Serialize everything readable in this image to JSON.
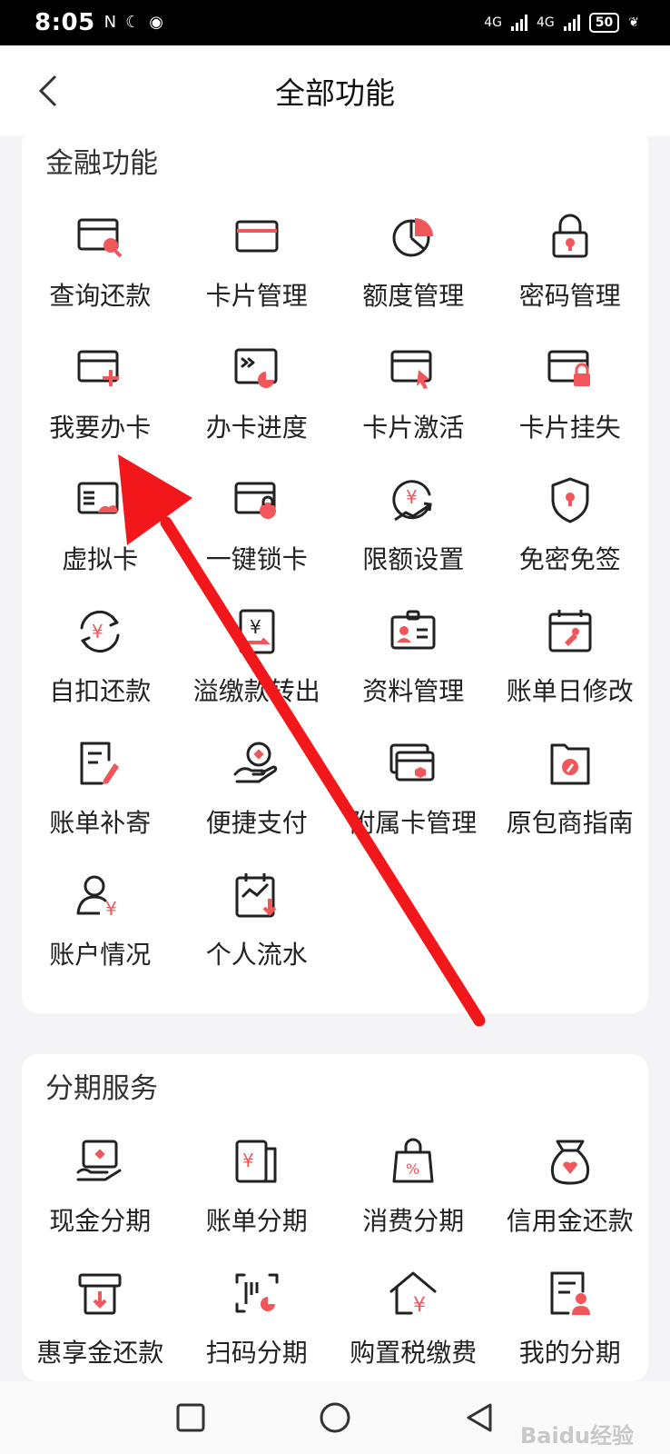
{
  "status_bar": {
    "time": "8:05",
    "network1": "4G",
    "network2": "4G",
    "battery": "50"
  },
  "header": {
    "title": "全部功能"
  },
  "sections": [
    {
      "title": "金融功能",
      "items": [
        {
          "label": "查询还款",
          "icon": "card-search-icon"
        },
        {
          "label": "卡片管理",
          "icon": "card-icon"
        },
        {
          "label": "额度管理",
          "icon": "pie-chart-icon"
        },
        {
          "label": "密码管理",
          "icon": "lock-icon"
        },
        {
          "label": "我要办卡",
          "icon": "card-add-icon"
        },
        {
          "label": "办卡进度",
          "icon": "card-progress-icon"
        },
        {
          "label": "卡片激活",
          "icon": "card-activate-icon"
        },
        {
          "label": "卡片挂失",
          "icon": "card-lock-icon"
        },
        {
          "label": "虚拟卡",
          "icon": "virtual-card-icon"
        },
        {
          "label": "一键锁卡",
          "icon": "card-onekey-lock-icon"
        },
        {
          "label": "限额设置",
          "icon": "limit-setting-icon"
        },
        {
          "label": "免密免签",
          "icon": "shield-icon"
        },
        {
          "label": "自扣还款",
          "icon": "auto-repay-icon"
        },
        {
          "label": "溢缴款转出",
          "icon": "overpay-transfer-icon"
        },
        {
          "label": "资料管理",
          "icon": "id-card-icon"
        },
        {
          "label": "账单日修改",
          "icon": "calendar-edit-icon"
        },
        {
          "label": "账单补寄",
          "icon": "bill-resend-icon"
        },
        {
          "label": "便捷支付",
          "icon": "hand-coin-icon"
        },
        {
          "label": "附属卡管理",
          "icon": "supplementary-card-icon"
        },
        {
          "label": "原包商指南",
          "icon": "guide-compass-icon"
        },
        {
          "label": "账户情况",
          "icon": "account-user-icon"
        },
        {
          "label": "个人流水",
          "icon": "statement-icon"
        }
      ]
    },
    {
      "title": "分期服务",
      "items": [
        {
          "label": "现金分期",
          "icon": "cash-installment-icon"
        },
        {
          "label": "账单分期",
          "icon": "bill-installment-icon"
        },
        {
          "label": "消费分期",
          "icon": "shopping-bag-icon"
        },
        {
          "label": "信用金还款",
          "icon": "money-bag-icon"
        },
        {
          "label": "惠享金还款",
          "icon": "atm-download-icon"
        },
        {
          "label": "扫码分期",
          "icon": "scan-code-icon"
        },
        {
          "label": "购置税缴费",
          "icon": "house-tax-icon"
        },
        {
          "label": "我的分期",
          "icon": "my-installment-icon"
        }
      ]
    }
  ],
  "watermark": "Baidu经验",
  "colors": {
    "accent": "#f0565a",
    "line": "#222222",
    "annotation_arrow": "#f2171b"
  }
}
